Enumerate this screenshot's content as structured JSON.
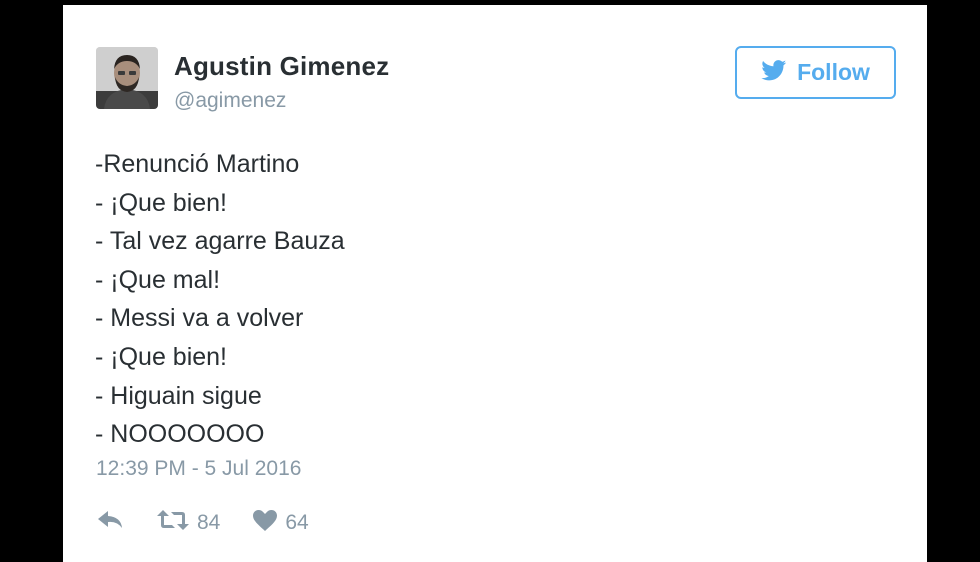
{
  "tweet": {
    "author": {
      "display_name": "Agustin Gimenez",
      "handle": "@agimenez"
    },
    "follow_label": "Follow",
    "lines": [
      "-Renunció Martino",
      "- ¡Que bien!",
      "- Tal vez agarre Bauza",
      "- ¡Que mal!",
      "- Messi va a volver",
      "- ¡Que bien!",
      "- Higuain sigue",
      "- NOOOOOOO"
    ],
    "timestamp": "12:39 PM - 5 Jul 2016",
    "retweet_count": "84",
    "like_count": "64"
  },
  "icons": {
    "follow": "twitter-bird-icon",
    "reply": "reply-icon",
    "retweet": "retweet-icon",
    "like": "heart-icon"
  },
  "colors": {
    "brand": "#55acee",
    "text": "#292f33",
    "muted": "#8899a6"
  }
}
